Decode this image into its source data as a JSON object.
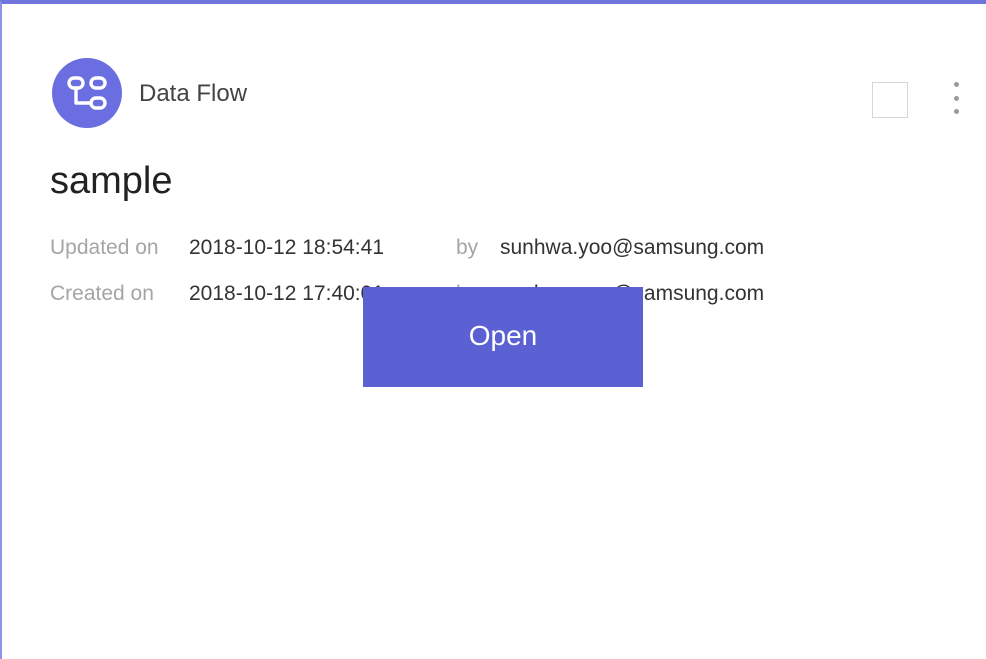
{
  "card": {
    "type_icon": "data-flow-icon",
    "type_label": "Data Flow",
    "title": "sample",
    "updated": {
      "label": "Updated on",
      "date": "2018-10-12 18:54:41",
      "by_label": "by",
      "user": "sunhwa.yoo@samsung.com"
    },
    "created": {
      "label": "Created on",
      "date": "2018-10-12 17:40:01",
      "by_label": "by",
      "user": "sunhwa.yoo@samsung.com"
    },
    "open_button_label": "Open",
    "checkbox_checked": false,
    "more_icon": "more-vertical-icon"
  },
  "colors": {
    "accent": "#5b61d3",
    "icon_background": "#6b6ee0",
    "top_border": "#6e76db"
  }
}
